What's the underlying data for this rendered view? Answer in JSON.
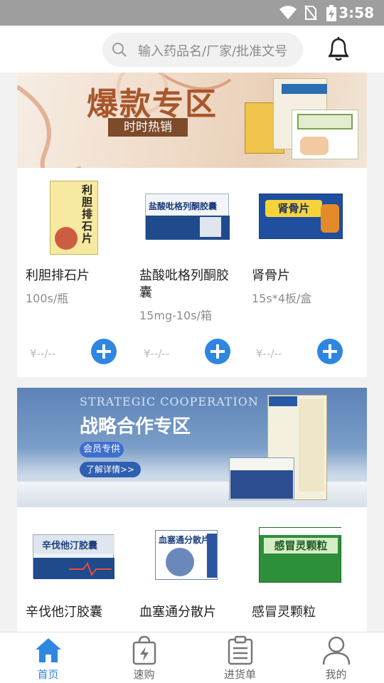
{
  "status_bar": {
    "time": "3:58"
  },
  "search": {
    "placeholder": "输入药品名/厂家/批准文号"
  },
  "sections": [
    {
      "banner": {
        "title": "爆款专区",
        "subtitle": "时时热销"
      },
      "products": [
        {
          "name": "利胆排石片",
          "spec": "100s/瓶",
          "price": "¥--/--",
          "box_text": "利胆排石片"
        },
        {
          "name": "盐酸吡格列酮胶囊",
          "spec": "15mg-10s/箱",
          "price": "¥--/--",
          "box_text": "盐酸吡格列酮胶囊"
        },
        {
          "name": "肾骨片",
          "spec": "15s*4板/盒",
          "price": "¥--/--",
          "box_text": "肾骨片"
        }
      ]
    },
    {
      "banner": {
        "subtitle_en": "STRATEGIC COOPERATION",
        "title": "战略合作专区",
        "vip": "会员专供",
        "more": "了解详情>>"
      },
      "products": [
        {
          "name": "辛伐他汀胶囊",
          "box_text": "辛伐他汀胶囊"
        },
        {
          "name": "血塞通分散片",
          "box_text": "血塞通分散片"
        },
        {
          "name": "感冒灵颗粒",
          "box_text": "感冒灵颗粒"
        }
      ]
    }
  ],
  "tabs": [
    {
      "label": "首页",
      "icon": "home-icon",
      "active": true
    },
    {
      "label": "速购",
      "icon": "quick-buy-bag-icon",
      "active": false
    },
    {
      "label": "进货单",
      "icon": "order-list-icon",
      "active": false
    },
    {
      "label": "我的",
      "icon": "profile-icon",
      "active": false
    }
  ],
  "colors": {
    "accent": "#2f86e0",
    "status_bar": "#9e9e9e"
  }
}
